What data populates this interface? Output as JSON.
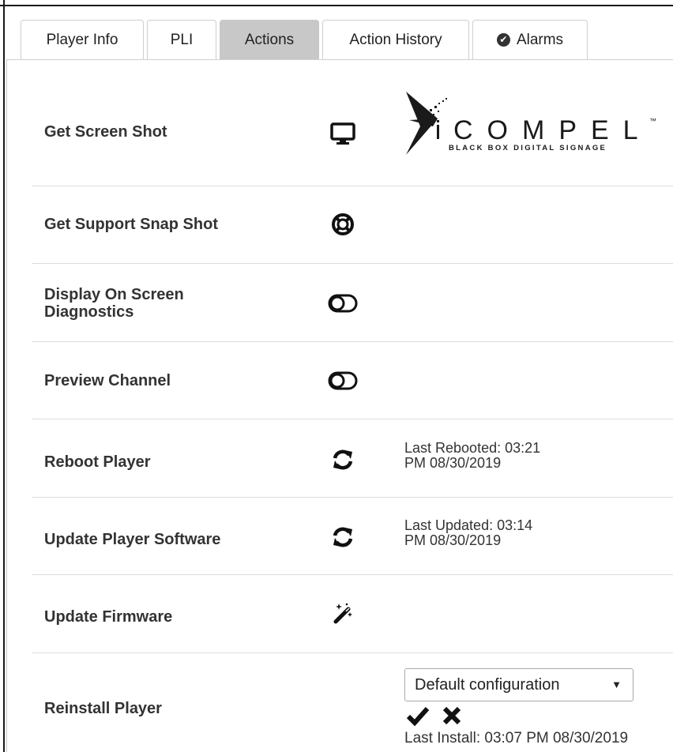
{
  "tabs": [
    {
      "label": "Player Info",
      "active": false
    },
    {
      "label": "PLI",
      "active": false
    },
    {
      "label": "Actions",
      "active": true
    },
    {
      "label": "Action History",
      "active": false
    },
    {
      "label": "Alarms",
      "active": false,
      "icon": "check-circle-icon"
    }
  ],
  "logo": {
    "wordmark": "iCOMPEL",
    "trademark": "™",
    "tagline": "BLACK BOX DIGITAL SIGNAGE"
  },
  "actions": [
    {
      "label": "Get Screen Shot",
      "icon": "monitor-icon"
    },
    {
      "label": "Get Support Snap Shot",
      "icon": "life-ring-icon"
    },
    {
      "label_line1": "Display On Screen",
      "label_line2": "Diagnostics",
      "icon": "toggle-off-icon"
    },
    {
      "label": "Preview Channel",
      "icon": "toggle-off-icon"
    },
    {
      "label": "Reboot Player",
      "icon": "refresh-icon",
      "info_line1": "Last Rebooted: 03:21",
      "info_line2": "PM 08/30/2019"
    },
    {
      "label": "Update Player Software",
      "icon": "refresh-icon",
      "info_line1": "Last Updated: 03:14",
      "info_line2": "PM 08/30/2019"
    },
    {
      "label": "Update Firmware",
      "icon": "magic-wand-icon"
    },
    {
      "label": "Reinstall Player",
      "icon": "none"
    }
  ],
  "reinstall": {
    "selected": "Default configuration",
    "caret": "▼",
    "last_install": "Last Install: 03:07 PM 08/30/2019"
  },
  "colors": {
    "active_tab": "#c8c8c8",
    "text": "#333333",
    "separator": "#dcdcdc"
  }
}
